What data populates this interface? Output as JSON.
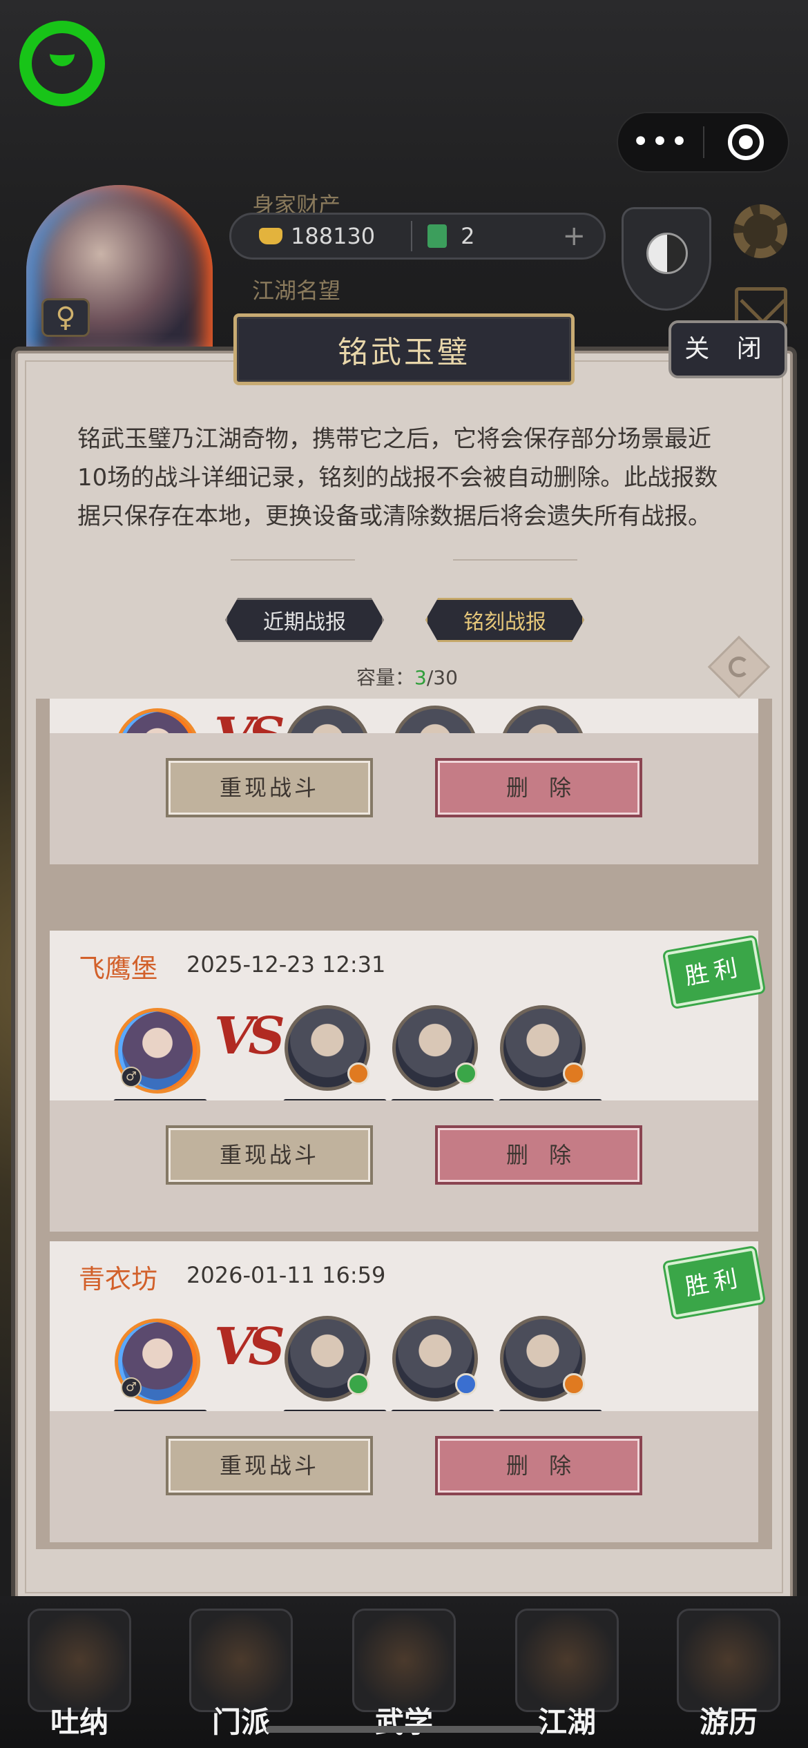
{
  "hud": {
    "wealth_label": "身家财产",
    "gold": "188130",
    "jade": "2",
    "plus": "+",
    "fame_label": "江湖名望",
    "gender": "♀"
  },
  "capsule": {
    "more": "•••"
  },
  "dialog": {
    "title": "铭武玉璧",
    "close": "关 闭",
    "description": "铭武玉璧乃江湖奇物，携带它之后，它将会保存部分场景最近10场的战斗详细记录，铭刻的战报不会被自动删除。此战报数据只保存在本地，更换设备或清除数据后将会遗失所有战报。",
    "tabs": {
      "recent": "近期战报",
      "engraved": "铭刻战报"
    },
    "capacity_label": "容量：",
    "capacity_current": "3",
    "capacity_max": "/30"
  },
  "records": [
    {
      "location": "",
      "time": "",
      "vs": "VS",
      "replay": "重现战斗",
      "delete": "删除",
      "result": ""
    },
    {
      "location": "飞鹰堡",
      "time": "2025-12-23 12:31",
      "vs": "VS",
      "replay": "重现战斗",
      "delete": "删除",
      "result": "胜利"
    },
    {
      "location": "青衣坊",
      "time": "2026-01-11 16:59",
      "vs": "VS",
      "replay": "重现战斗",
      "delete": "删除",
      "result": "胜利"
    }
  ],
  "player_gender": "♂",
  "nav": [
    {
      "label": "吐纳"
    },
    {
      "label": "门派"
    },
    {
      "label": "武学"
    },
    {
      "label": "江湖"
    },
    {
      "label": "游历"
    }
  ],
  "colors": {
    "win_green": "#3aa648",
    "location_orange": "#d2602a",
    "capacity_green": "#2f9e3a",
    "delete_pink": "#c57c86"
  }
}
